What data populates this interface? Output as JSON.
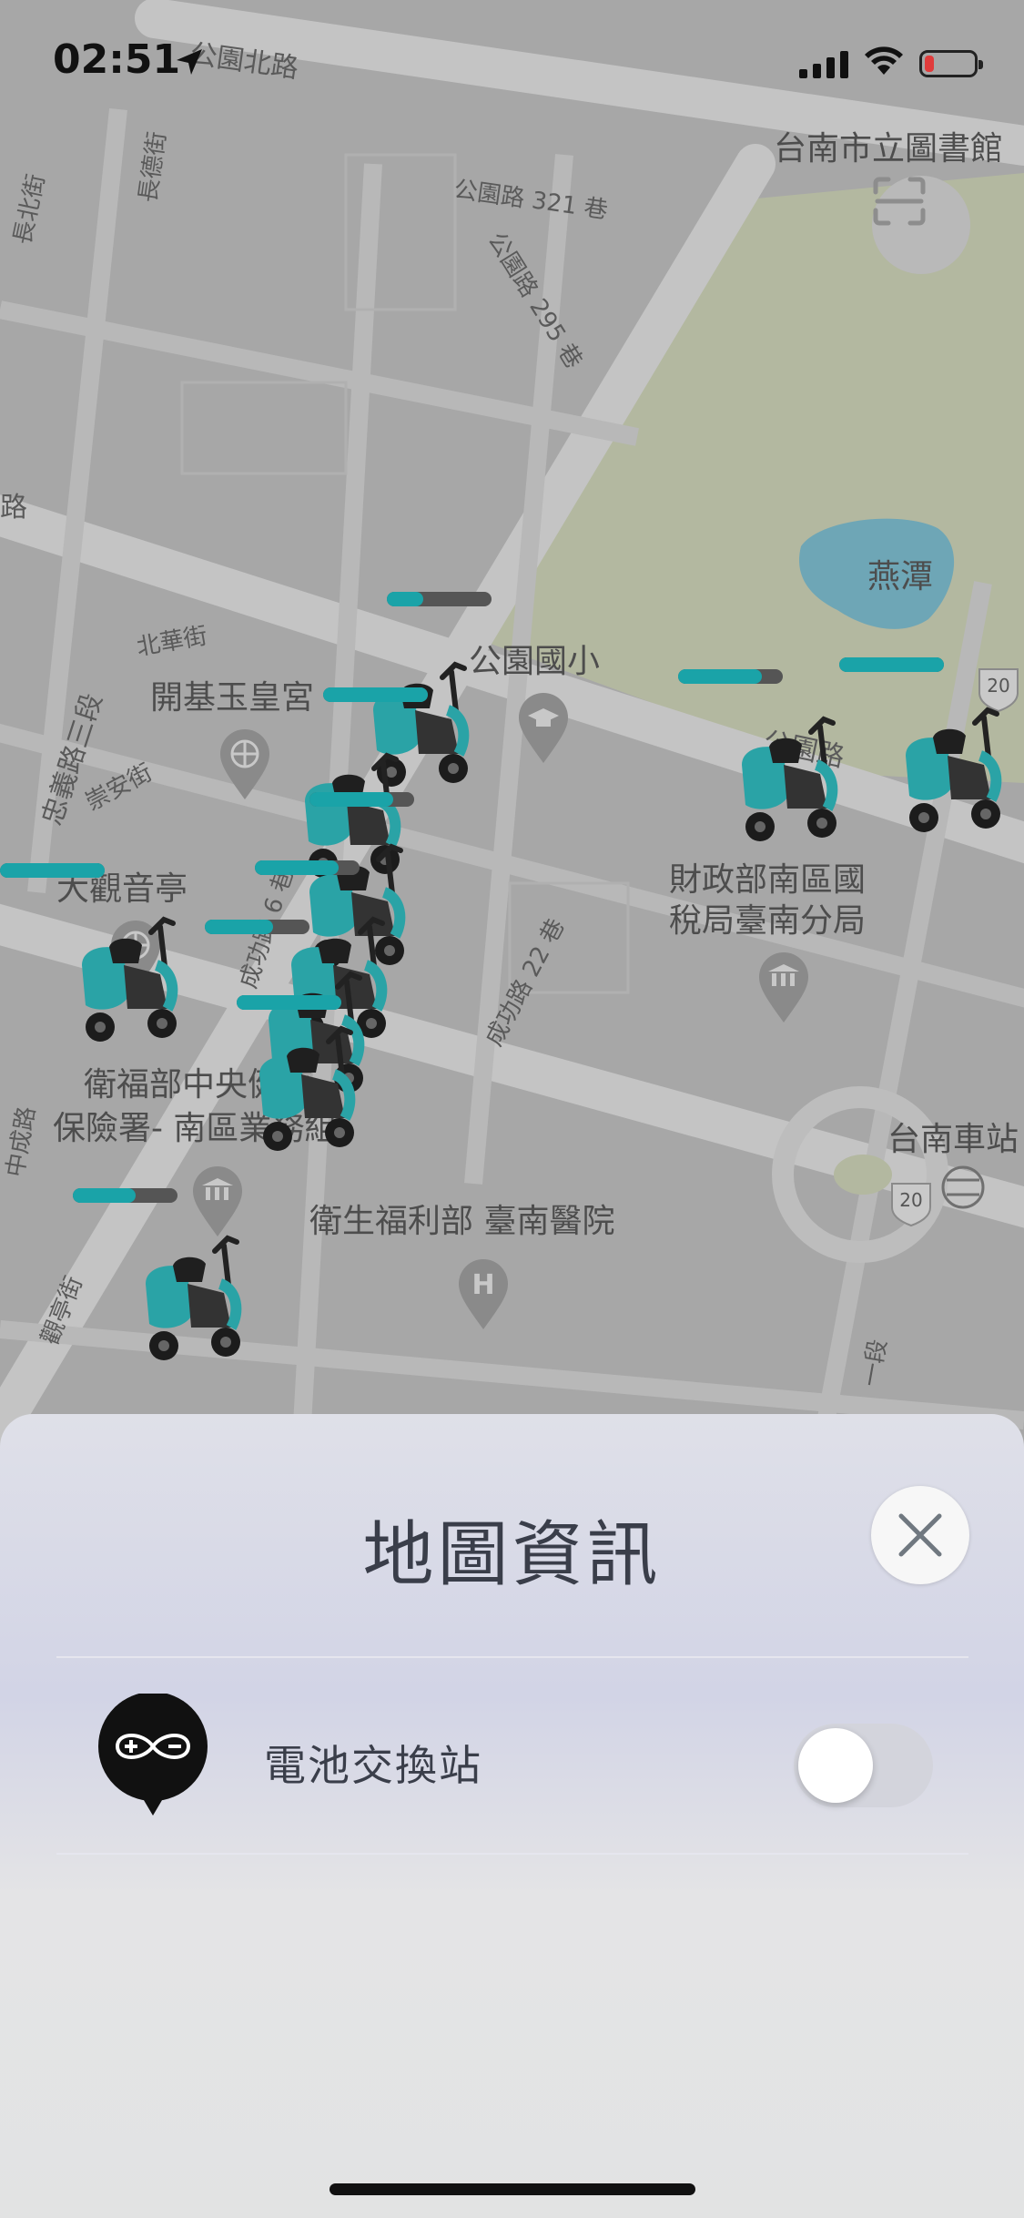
{
  "status_bar": {
    "time": "02:51"
  },
  "map": {
    "labels": {
      "gongyuan_north_rd": "公園北路",
      "changbei_st": "長北街",
      "changde_st": "長德街",
      "library": "台南市立圖書館",
      "lane_321": "公園路 321 巷",
      "lane_295": "公園路 295 巷",
      "road_edge": "路",
      "yan_pond": "燕潭",
      "beihua_st": "北華街",
      "zhongyi_rd": "忠義路三段",
      "kaiji_temple": "開基玉皇宮",
      "chongan_st": "崇安街",
      "gongyuan_elem": "公園國小",
      "gongyuan_rd": "公園路",
      "route_20a": "20",
      "guanyin": "大觀音亭",
      "chenggong_lane6": "成功路 6 巷",
      "tax_office_line1": "財政部南區國",
      "tax_office_line2": "稅局臺南分局",
      "chenggong_lane22": "成功路 22 巷",
      "nhi_line1": "衛福部中央健康",
      "nhi_line2": "保險署- 南區業務組",
      "zhongcheng_rd": "中成路",
      "tainan_station": "台南車站",
      "route_20b": "20",
      "tainan_hospital": "衛生福利部 臺南醫院",
      "guanting_st": "觀亭街",
      "section_1": "一段"
    },
    "scooters": [
      {
        "id": "s1",
        "battery": 0.35
      },
      {
        "id": "s2",
        "battery": 1.0
      },
      {
        "id": "s3",
        "battery": 0.8
      },
      {
        "id": "s4",
        "battery": 0.8
      },
      {
        "id": "s5",
        "battery": 0.65
      },
      {
        "id": "s6",
        "battery": 1.0
      },
      {
        "id": "s7",
        "battery": 1.0
      },
      {
        "id": "s8",
        "battery": 0.6
      },
      {
        "id": "s9",
        "battery": 0.8
      },
      {
        "id": "s10",
        "battery": 1.0
      }
    ]
  },
  "sheet": {
    "title": "地圖資訊",
    "rows": [
      {
        "label": "電池交換站",
        "toggle_on": false
      }
    ]
  },
  "colors": {
    "accent": "#1aa3a8",
    "battery_low": "#e03b3b",
    "park": "#bfc6a2",
    "water": "#6eb3c4"
  }
}
